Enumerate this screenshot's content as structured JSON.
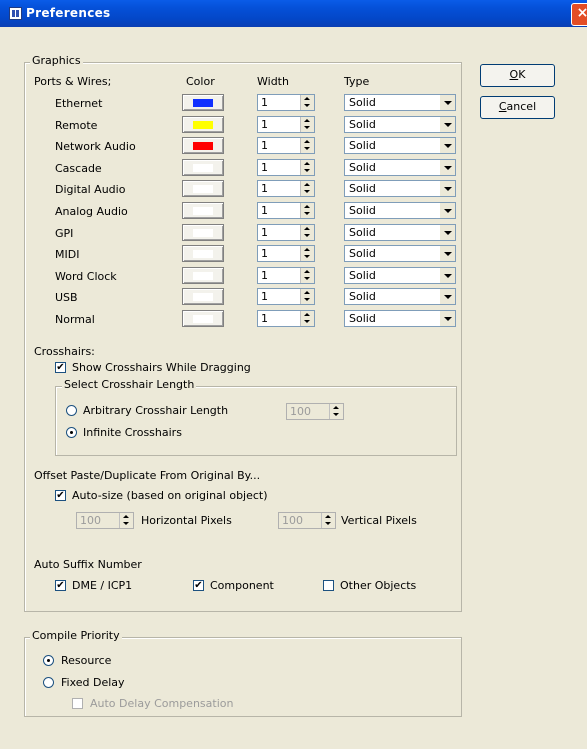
{
  "window": {
    "title": "Preferences",
    "close_glyph": "×"
  },
  "buttons": {
    "ok": "OK",
    "cancel": "Cancel"
  },
  "graphics": {
    "legend": "Graphics",
    "headers": {
      "ports": "Ports & Wires;",
      "color": "Color",
      "width": "Width",
      "type": "Type"
    },
    "rows": [
      {
        "label": "Ethernet",
        "color": "#1030ff",
        "width": "1",
        "type": "Solid"
      },
      {
        "label": "Remote",
        "color": "#ffff00",
        "width": "1",
        "type": "Solid"
      },
      {
        "label": "Network Audio",
        "color": "#ff0000",
        "width": "1",
        "type": "Solid"
      },
      {
        "label": "Cascade",
        "color": "#ffffff",
        "width": "1",
        "type": "Solid"
      },
      {
        "label": "Digital Audio",
        "color": "#ffffff",
        "width": "1",
        "type": "Solid"
      },
      {
        "label": "Analog Audio",
        "color": "#ffffff",
        "width": "1",
        "type": "Solid"
      },
      {
        "label": "GPI",
        "color": "#ffffff",
        "width": "1",
        "type": "Solid"
      },
      {
        "label": "MIDI",
        "color": "#ffffff",
        "width": "1",
        "type": "Solid"
      },
      {
        "label": "Word Clock",
        "color": "#ffffff",
        "width": "1",
        "type": "Solid"
      },
      {
        "label": "USB",
        "color": "#ffffff",
        "width": "1",
        "type": "Solid"
      },
      {
        "label": "Normal",
        "color": "#ffffff",
        "width": "1",
        "type": "Solid"
      }
    ],
    "crosshairs": {
      "label": "Crosshairs:",
      "show_label": "Show Crosshairs While Dragging",
      "show_checked": "✔",
      "length_legend": "Select Crosshair Length",
      "arbitrary_label": "Arbitrary Crosshair Length",
      "arbitrary_value": "100",
      "infinite_label": "Infinite Crosshairs",
      "selected": "infinite"
    },
    "offset": {
      "label": "Offset Paste/Duplicate From Original By...",
      "autosize_label": "Auto-size (based on original object)",
      "autosize_checked": "✔",
      "h_value": "100",
      "h_label": "Horizontal Pixels",
      "v_value": "100",
      "v_label": "Vertical Pixels"
    },
    "suffix": {
      "label": "Auto Suffix Number",
      "dme_label": "DME / ICP1",
      "dme_checked": "✔",
      "component_label": "Component",
      "component_checked": "✔",
      "other_label": "Other Objects",
      "other_checked": ""
    }
  },
  "compile": {
    "legend": "Compile Priority",
    "resource_label": "Resource",
    "fixed_label": "Fixed Delay",
    "auto_delay_label": "Auto Delay Compensation",
    "selected": "resource"
  }
}
